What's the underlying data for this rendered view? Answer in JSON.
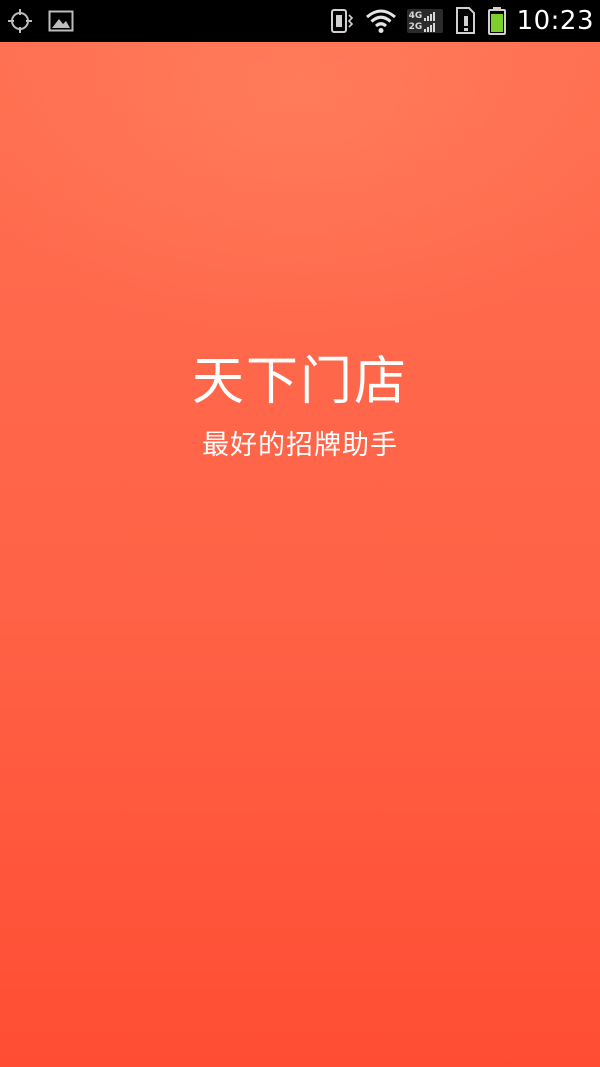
{
  "status_bar": {
    "time": "10:23",
    "network_badge": {
      "line1": "4G",
      "line2": "2G"
    },
    "left_icons": [
      "gps-icon",
      "image-icon"
    ],
    "right_icons": [
      "vibrate-icon",
      "wifi-icon",
      "signal-icon",
      "sim-alert-icon",
      "battery-icon"
    ],
    "battery_level": 0.8
  },
  "splash": {
    "title": "天下门店",
    "subtitle": "最好的招牌助手",
    "colors": {
      "top": "#ff6e50",
      "bottom": "#ff4d33",
      "text": "#ffffff"
    }
  }
}
